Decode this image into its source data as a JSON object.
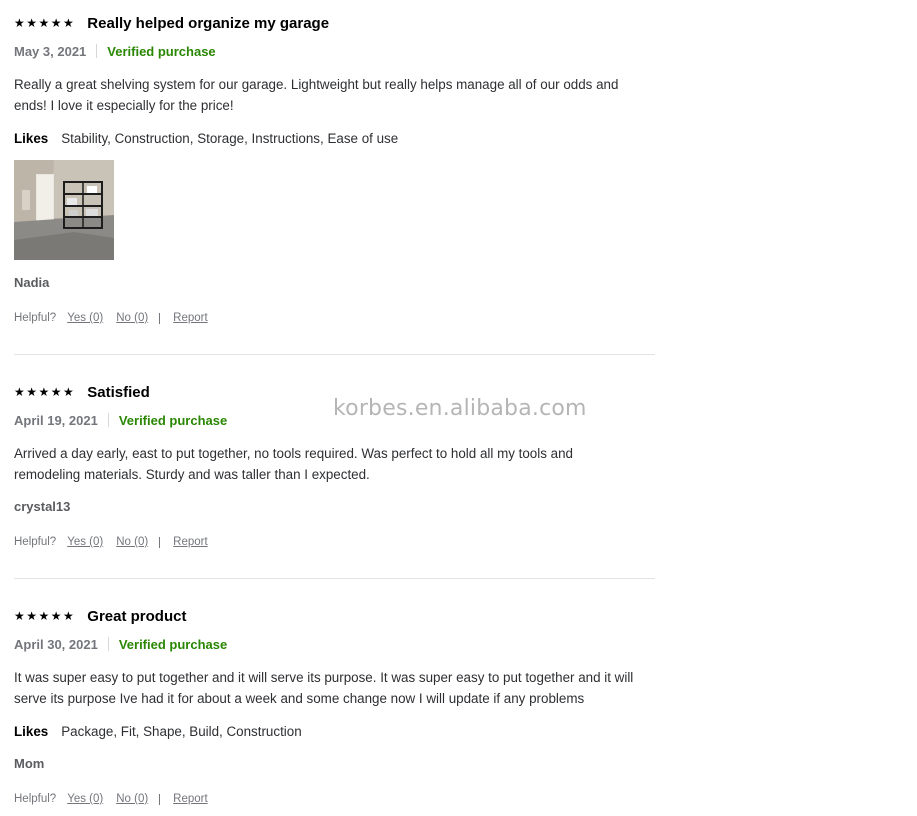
{
  "reviews": [
    {
      "stars": "★★★★★",
      "rating": 5,
      "title": "Really helped organize my garage",
      "date": "May 3, 2021",
      "verified": "Verified purchase",
      "body": "Really a great shelving system for our garage. Lightweight but really helps manage all of our odds and ends! I love it especially for the price!",
      "likes_label": "Likes",
      "likes": "Stability, Construction, Storage, Instructions, Ease of use",
      "author": "Nadia",
      "helpful_label": "Helpful?",
      "yes": "Yes (0)",
      "no": "No (0)",
      "report": "Report"
    },
    {
      "stars": "★★★★★",
      "rating": 5,
      "title": "Satisfied",
      "date": "April 19, 2021",
      "verified": "Verified purchase",
      "body": "Arrived a day early, east to put together, no tools required. Was perfect to hold all my tools and remodeling materials. Sturdy and was taller than I expected.",
      "author": "crystal13",
      "helpful_label": "Helpful?",
      "yes": "Yes (0)",
      "no": "No (0)",
      "report": "Report"
    },
    {
      "stars": "★★★★★",
      "rating": 5,
      "title": "Great product",
      "date": "April 30, 2021",
      "verified": "Verified purchase",
      "body": "It was super easy to put together and it will serve its purpose. It was super easy to put together and it will serve its purpose Ive had it for about a week and some change now I will update if any problems",
      "likes_label": "Likes",
      "likes": "Package, Fit, Shape, Build, Construction",
      "author": "Mom",
      "helpful_label": "Helpful?",
      "yes": "Yes (0)",
      "no": "No (0)",
      "report": "Report"
    }
  ],
  "watermark": "korbes.en.alibaba.com",
  "colors": {
    "verified": "#2a8703",
    "meta_gray": "#74767c",
    "divider": "#e3e4e5"
  }
}
